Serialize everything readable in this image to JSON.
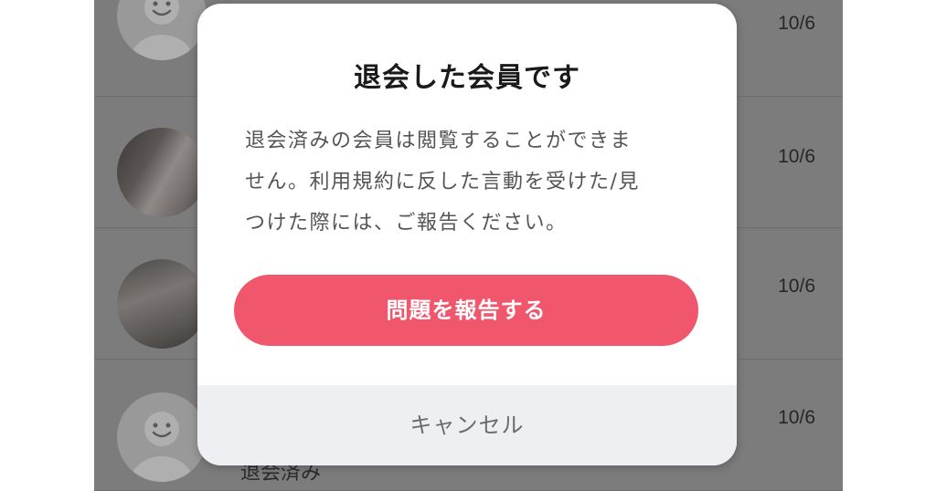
{
  "list": {
    "rows": [
      {
        "date": "10/6",
        "avatar": "default-avatar-icon"
      },
      {
        "date": "10/6",
        "avatar": "user-photo"
      },
      {
        "date": "10/6",
        "avatar": "user-photo"
      },
      {
        "date": "10/6",
        "avatar": "default-avatar-icon"
      }
    ],
    "withdrawn_label": "退会済み"
  },
  "modal": {
    "title": "退会した会員です",
    "message_lines": [
      "退会済みの会員は閲覧することができま",
      "せん。利用規約に反した言動を受けた/見",
      "つけた際には、ご報告ください。"
    ],
    "report_button_label": "問題を報告する",
    "cancel_label": "キャンセル"
  },
  "colors": {
    "accent": "#f0566c",
    "overlay": "#7d7c7c",
    "cancel_bg": "#eeeff3"
  }
}
